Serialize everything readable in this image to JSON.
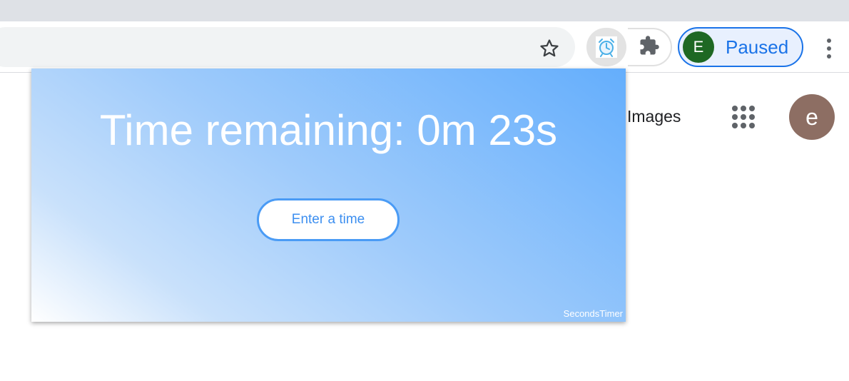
{
  "browser": {
    "profile": {
      "initial": "E",
      "status": "Paused"
    },
    "icons": [
      "star-icon",
      "alarm-clock-icon",
      "puzzle-icon",
      "more-vert-icon"
    ]
  },
  "page": {
    "images_link": "Images",
    "apps_icon": "apps-grid-icon",
    "account_initial": "e"
  },
  "popup": {
    "title": "Time remaining: 0m 23s",
    "button_label": "Enter a time",
    "brand": "SecondsTimer",
    "colors": {
      "gradient_start": "#ffffff",
      "gradient_end": "#64aefc",
      "accent": "#4a9bf5"
    }
  }
}
